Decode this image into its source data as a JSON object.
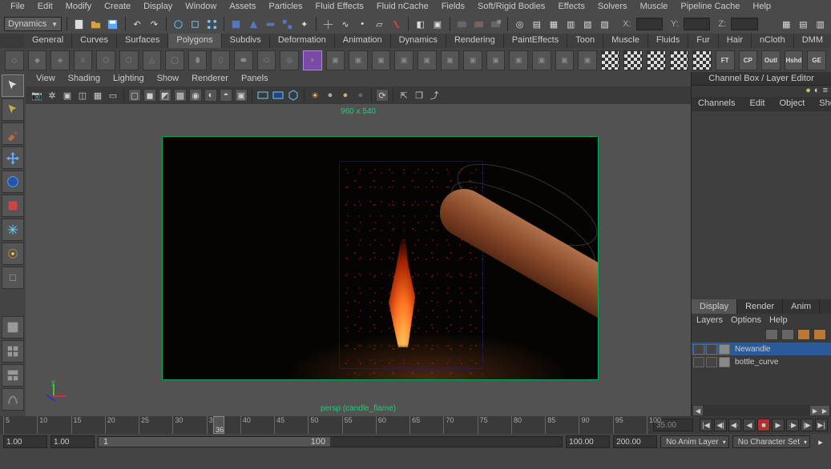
{
  "menubar": [
    "File",
    "Edit",
    "Modify",
    "Create",
    "Display",
    "Window",
    "Assets",
    "Particles",
    "Fluid Effects",
    "Fluid nCache",
    "Fields",
    "Soft/Rigid Bodies",
    "Effects",
    "Solvers",
    "Muscle",
    "Pipeline Cache",
    "Help"
  ],
  "module_dropdown": "Dynamics",
  "coords": {
    "x": "X:",
    "y": "Y:",
    "z": "Z:"
  },
  "shelf_tabs": [
    "General",
    "Curves",
    "Surfaces",
    "Polygons",
    "Subdivs",
    "Deformation",
    "Animation",
    "Dynamics",
    "Rendering",
    "PaintEffects",
    "Toon",
    "Muscle",
    "Fluids",
    "Fur",
    "Hair",
    "nCloth",
    "DMM"
  ],
  "shelf_active": 3,
  "shelf_labels": [
    "FT",
    "CP",
    "Outl",
    "Hshd",
    "GE"
  ],
  "vp_menus": [
    "View",
    "Shading",
    "Lighting",
    "Show",
    "Renderer",
    "Panels"
  ],
  "resolution": "960 x 540",
  "camera_label": "persp (candle_flame)",
  "right_panel_title": "Channel Box / Layer Editor",
  "channel_tabs": [
    "Channels",
    "Edit",
    "Object",
    "Show"
  ],
  "layer_tabs": [
    "Display",
    "Render",
    "Anim"
  ],
  "layer_active": 0,
  "layer_menus": [
    "Layers",
    "Options",
    "Help"
  ],
  "layers": [
    {
      "name": "Newandle",
      "selected": true
    },
    {
      "name": "bottle_curve",
      "selected": false
    }
  ],
  "timeline": {
    "start_tick": 5,
    "end_tick": 100,
    "step": 5,
    "current": 36,
    "current_box": "35.00"
  },
  "range": {
    "anim_start": "1.00",
    "range_start": "1.00",
    "thumb_start": "1",
    "thumb_end": "100",
    "range_end": "100.00",
    "anim_end": "200.00",
    "anim_layer": "No Anim Layer",
    "char_set": "No Character Set"
  }
}
